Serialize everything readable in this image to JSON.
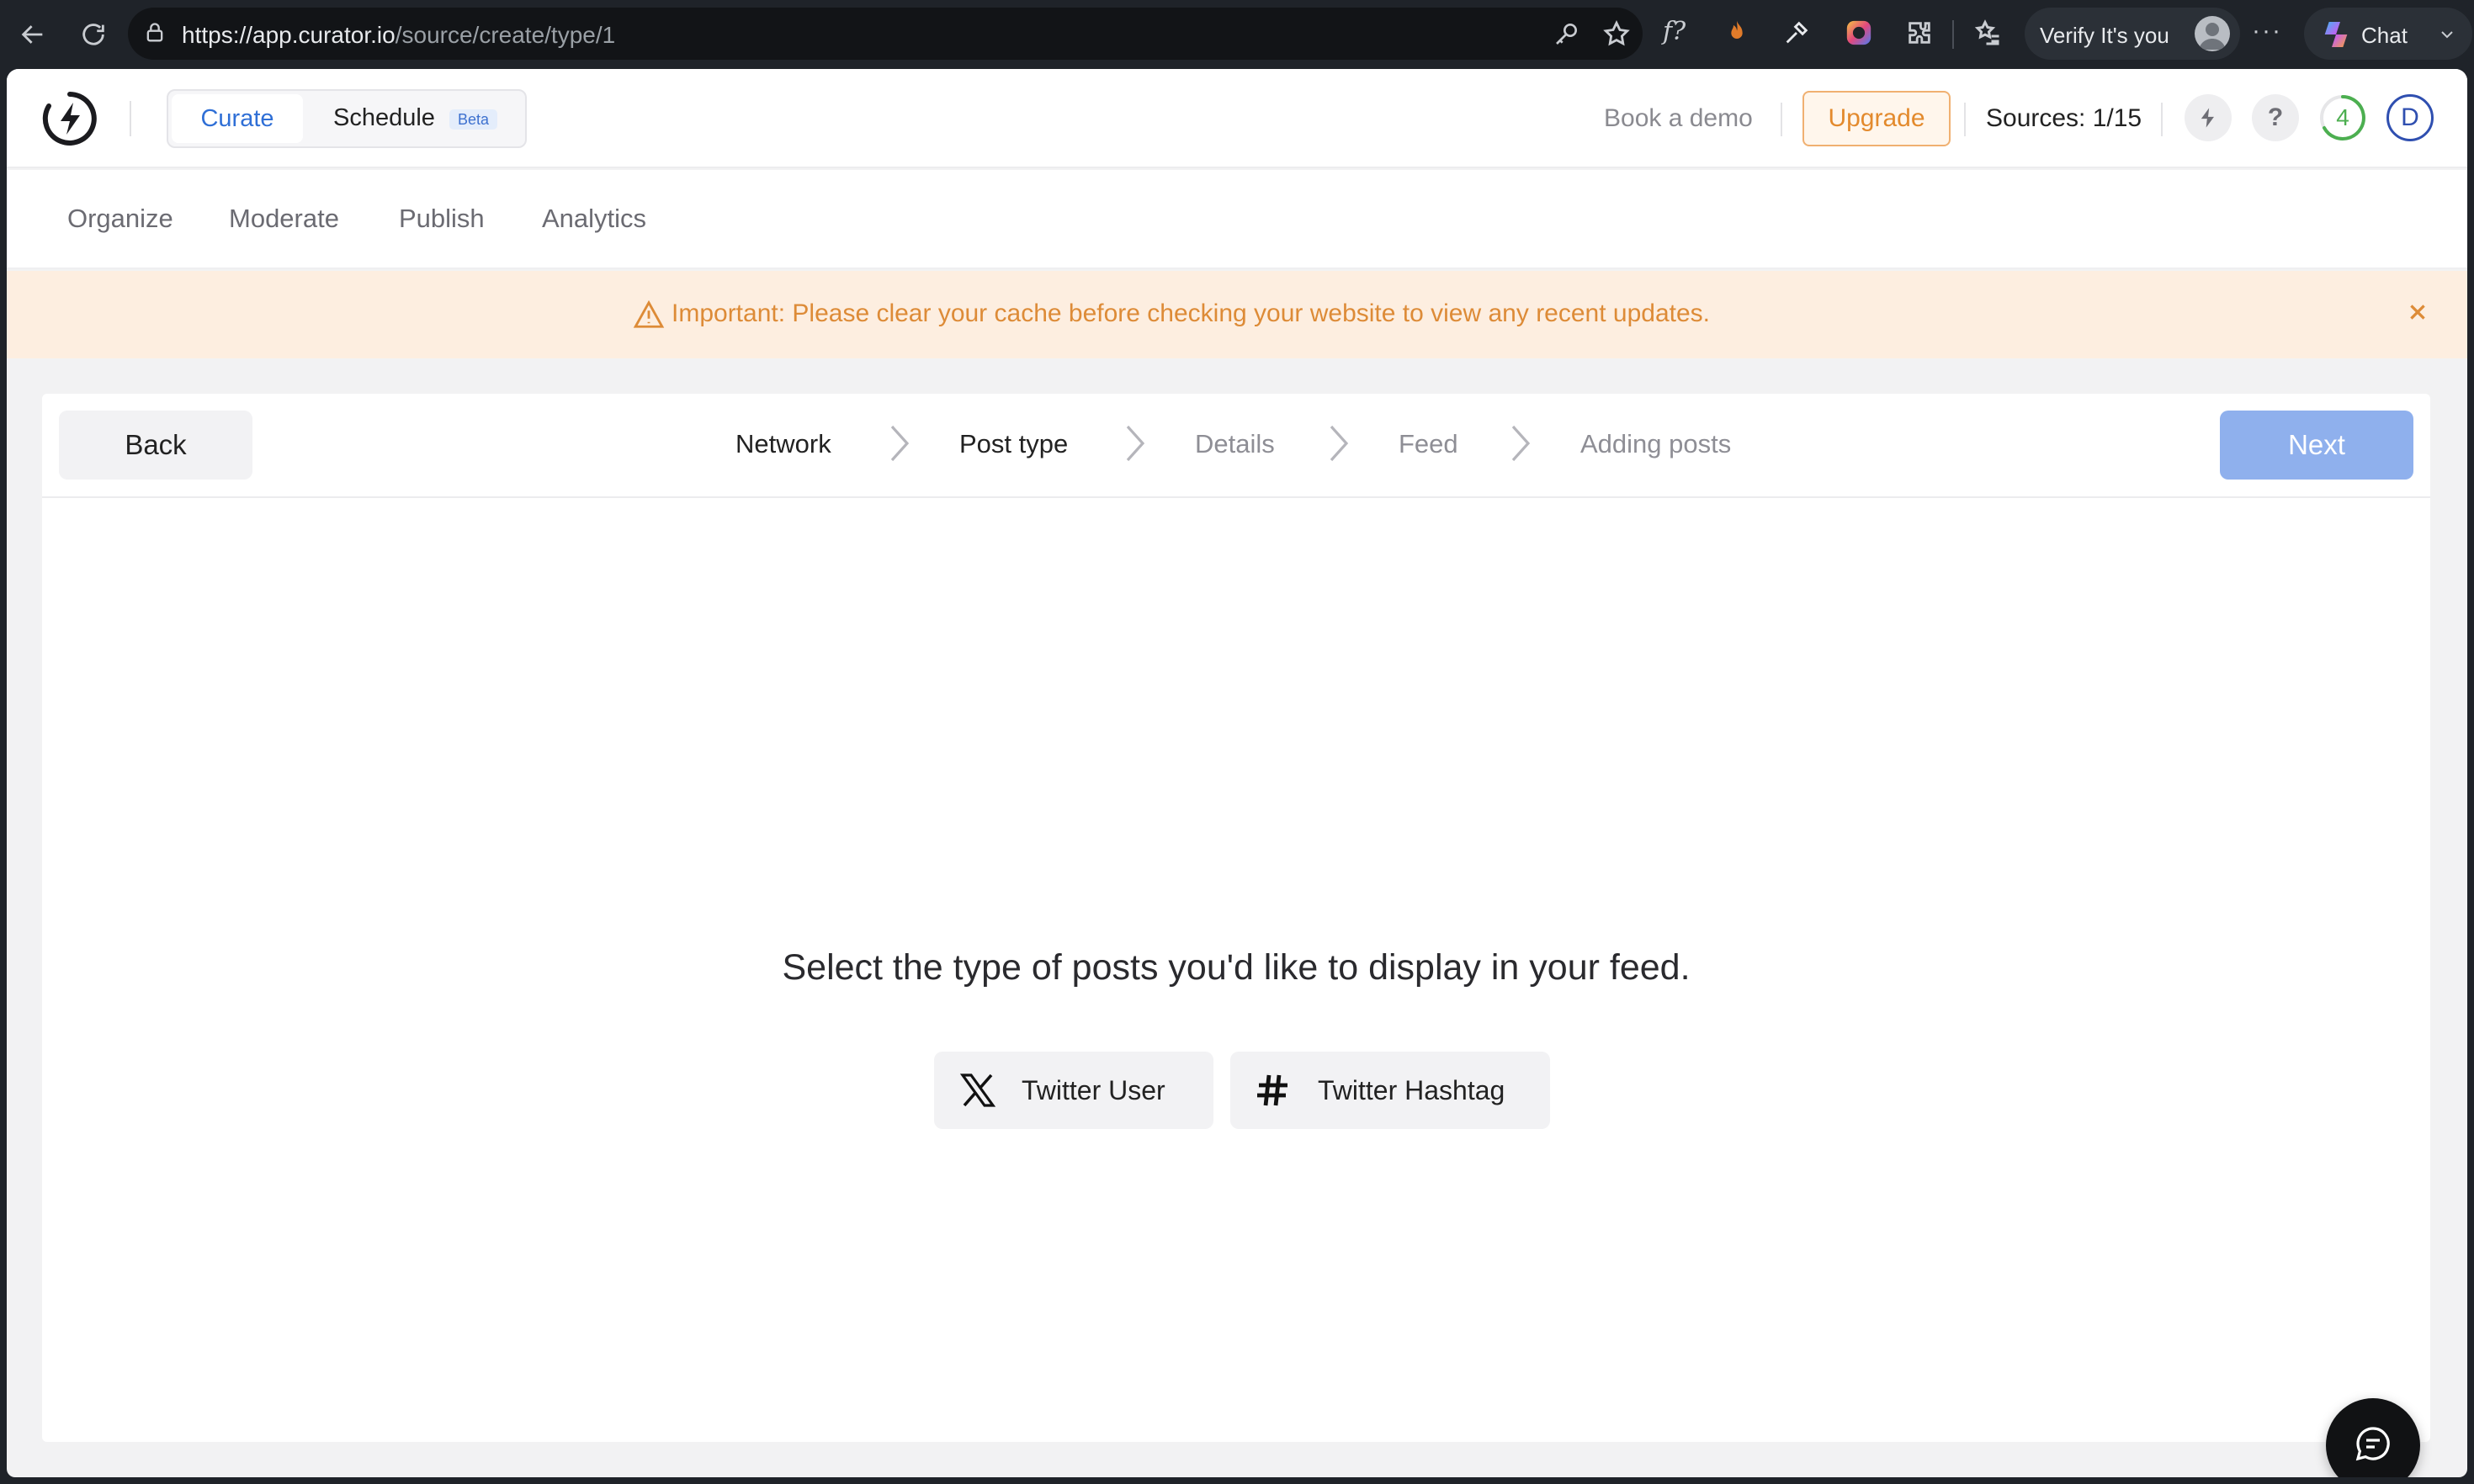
{
  "browser": {
    "url_domain": "https://app.curator.io",
    "url_path": "/source/create/type/1",
    "verify_label": "Verify It's you",
    "chat_label": "Chat",
    "extension_label": "f?"
  },
  "topbar": {
    "mode_curate": "Curate",
    "mode_schedule": "Schedule",
    "beta_badge": "Beta",
    "book_demo": "Book a demo",
    "upgrade": "Upgrade",
    "sources": "Sources: 1/15",
    "help": "?",
    "progress_count": "4",
    "avatar_initial": "D"
  },
  "nav": {
    "items": [
      "Organize",
      "Moderate",
      "Publish",
      "Analytics"
    ]
  },
  "banner": {
    "text": "Important: Please clear your cache before checking your website to view any recent updates."
  },
  "wizard": {
    "back": "Back",
    "next": "Next",
    "steps": [
      "Network",
      "Post type",
      "Details",
      "Feed",
      "Adding posts"
    ]
  },
  "content": {
    "prompt": "Select the type of posts you'd like to display in your feed.",
    "options": [
      "Twitter User",
      "Twitter Hashtag"
    ]
  },
  "colors": {
    "accent": "#2f6fd6",
    "upgrade": "#e38a2d",
    "banner_bg": "#fdeee0",
    "next_disabled": "#8fb0ed",
    "progress_ring": "#4caf50"
  }
}
